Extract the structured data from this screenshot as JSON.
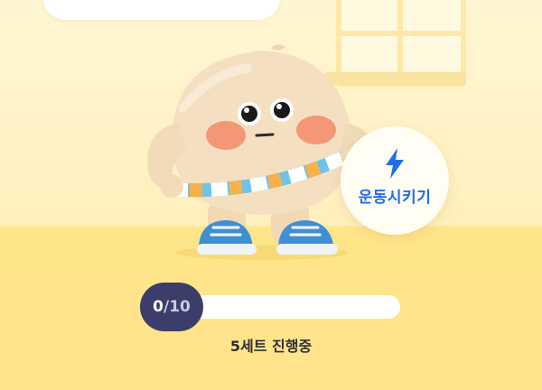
{
  "exercise_button": {
    "label": "운동시키기",
    "icon": "lightning-bolt-icon",
    "accent_color": "#1f6fe6"
  },
  "progress": {
    "current": "0",
    "separator": "/",
    "total": "10",
    "fraction": 0.0,
    "badge_color": "#3b3d6a"
  },
  "status_text": "5세트 진행중",
  "colors": {
    "wall": "#fff6d2",
    "floor": "#ffe58a"
  }
}
